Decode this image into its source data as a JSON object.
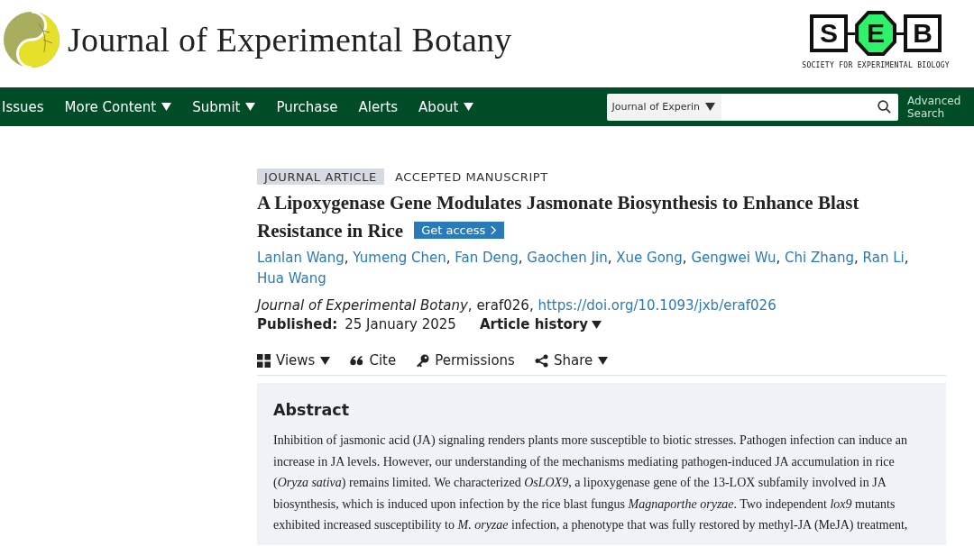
{
  "header": {
    "journal_title": "Journal of Experimental Botany",
    "society_logo": {
      "letters": [
        "S",
        "E",
        "B"
      ],
      "tagline": "SOCIETY FOR EXPERIMENTAL BIOLOGY"
    }
  },
  "nav": {
    "items": [
      {
        "label": "Issues",
        "has_menu": false
      },
      {
        "label": "More Content",
        "has_menu": true
      },
      {
        "label": "Submit",
        "has_menu": true
      },
      {
        "label": "Purchase",
        "has_menu": false
      },
      {
        "label": "Alerts",
        "has_menu": false
      },
      {
        "label": "About",
        "has_menu": true
      }
    ],
    "search": {
      "scope": "Journal of Experin",
      "advanced": "Advanced Search"
    }
  },
  "article": {
    "tags": [
      {
        "label": "JOURNAL ARTICLE",
        "kind": "type"
      },
      {
        "label": "ACCEPTED MANUSCRIPT",
        "kind": "status"
      }
    ],
    "title": "A Lipoxygenase Gene Modulates Jasmonate Biosynthesis to Enhance Blast Resistance in Rice",
    "access_button": "Get access",
    "authors": [
      {
        "name": "Lanlan Wang",
        "separator": ","
      },
      {
        "name": "Yumeng Chen",
        "separator": ","
      },
      {
        "name": "Fan Deng",
        "separator": ","
      },
      {
        "name": "Gaochen Jin",
        "separator": ","
      },
      {
        "name": "Xue Gong",
        "separator": ","
      },
      {
        "name": "Gengwei Wu",
        "separator": ","
      },
      {
        "name": "Chi Zhang",
        "separator": ","
      },
      {
        "name": "Ran Li",
        "separator": ","
      },
      {
        "name": "Hua Wang"
      }
    ],
    "citation": {
      "text": "*Journal of Experimental Botany*, eraf026,",
      "doi": "https://doi.org/10.1093/jxb/eraf026"
    },
    "published": {
      "label": "Published:",
      "date": "25 January 2025"
    },
    "history": "Article history",
    "tools": [
      {
        "label": "Views",
        "kind": "views",
        "has_menu": true
      },
      {
        "label": "Cite",
        "kind": "cite",
        "has_menu": false
      },
      {
        "label": "Permissions",
        "kind": "permissions",
        "has_menu": false
      },
      {
        "label": "Share",
        "kind": "share",
        "has_menu": true
      }
    ],
    "abstract": {
      "heading": "Abstract",
      "text": "Inhibition of jasmonic acid (JA) signaling renders plants more susceptible to biotic stresses. Pathogen infection can induce an increase in JA levels. However, our understanding of the mechanisms mediating pathogen-induced JA accumulation in rice (*Oryza sativa*) remains limited. We characterized *OsLOX9*, a lipoxygenase gene of the 13-LOX subfamily involved in JA biosynthesis, which is induced upon infection by the rice blast fungus *Magnaporthe oryzae*. Two independent *lox9* mutants exhibited increased susceptibility to *M. oryzae* infection, a phenotype that was fully restored by methyl-JA (MeJA) treatment,"
    }
  }
}
